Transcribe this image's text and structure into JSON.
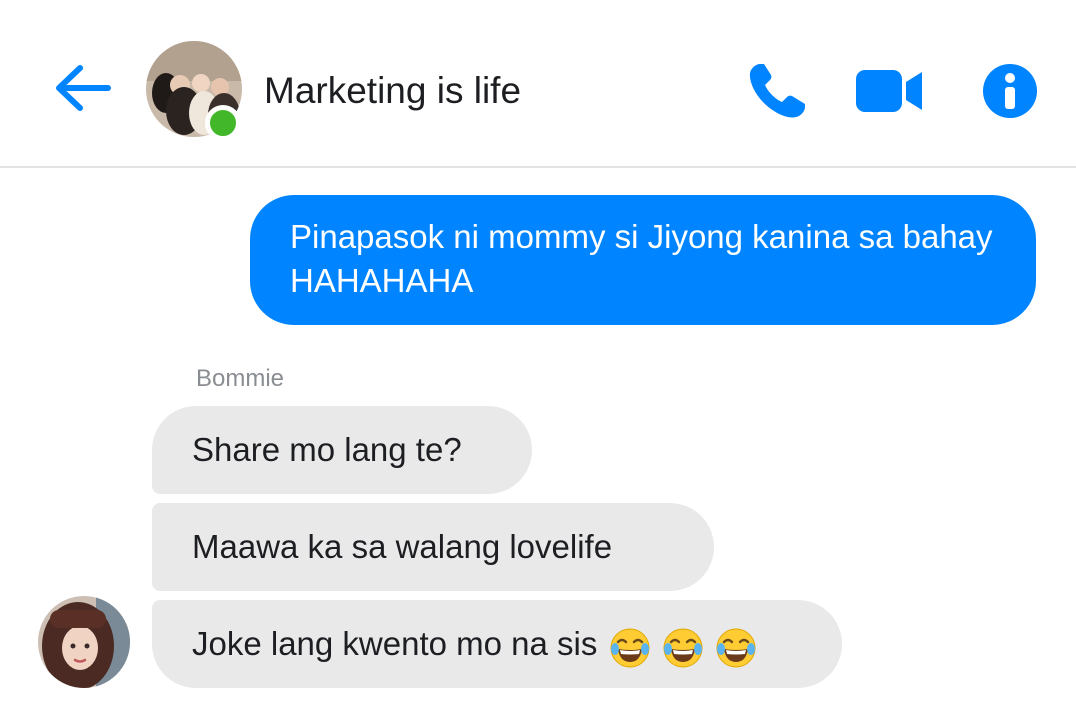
{
  "header": {
    "back_icon": "arrow-left-icon",
    "title": "Marketing is life",
    "online_status_color": "#42b72a",
    "actions": [
      {
        "name": "phone-icon"
      },
      {
        "name": "video-camera-icon"
      },
      {
        "name": "info-icon"
      }
    ],
    "accent_color": "#0084ff"
  },
  "messages": {
    "outgoing": {
      "text": "Pinapasok ni mommy si Jiyong kanina sa bahay HAHAHAHA"
    },
    "incoming_sender": "Bommie",
    "incoming": [
      {
        "text": "Share mo lang te?"
      },
      {
        "text": "Maawa ka sa walang lovelife"
      },
      {
        "text": "Joke lang kwento mo na sis",
        "emoji": [
          "face-with-tears-of-joy",
          "face-with-tears-of-joy",
          "face-with-tears-of-joy"
        ]
      }
    ]
  }
}
